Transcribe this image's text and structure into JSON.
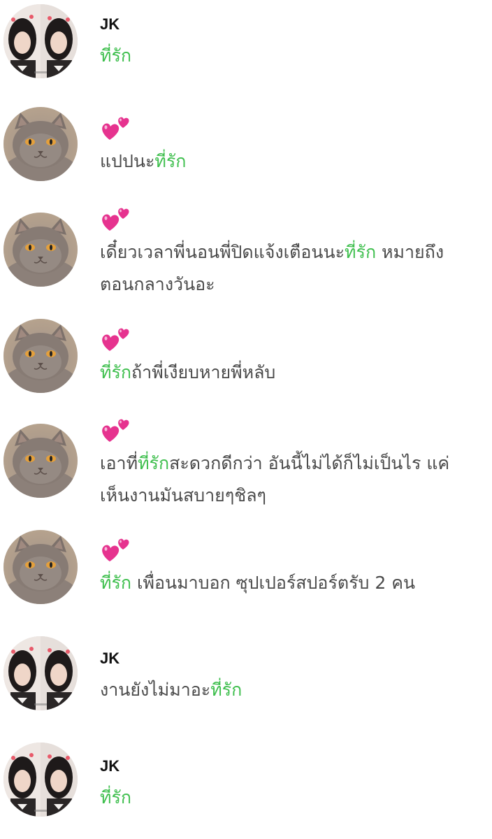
{
  "colors": {
    "highlight": "#3fbf4e",
    "body_text": "#4a4a4a",
    "sender": "#111111",
    "heart": "#e6338f"
  },
  "messages": [
    {
      "sender": "JK",
      "avatar": "jk-photo-avatar",
      "parts": [
        {
          "t": "ที่รัก",
          "hl": true
        }
      ]
    },
    {
      "avatar": "cat-avatar",
      "reaction": "two-hearts-icon",
      "parts": [
        {
          "t": "แปปนะ",
          "hl": false
        },
        {
          "t": "ที่รัก",
          "hl": true
        }
      ]
    },
    {
      "avatar": "cat-avatar",
      "reaction": "two-hearts-icon",
      "parts": [
        {
          "t": "เดี๋ยวเวลาพี่นอนพี่ปิดแจ้งเตือนนะ",
          "hl": false
        },
        {
          "t": "ที่รัก",
          "hl": true
        },
        {
          "t": " หมายถึง",
          "hl": false
        },
        {
          "br": true
        },
        {
          "t": "ตอนกลางวันอะ",
          "hl": false
        }
      ]
    },
    {
      "avatar": "cat-avatar",
      "reaction": "two-hearts-icon",
      "parts": [
        {
          "t": "ที่รัก",
          "hl": true
        },
        {
          "t": "ถ้าพี่เงียบหายพี่หลับ",
          "hl": false
        }
      ]
    },
    {
      "avatar": "cat-avatar",
      "reaction": "two-hearts-icon",
      "parts": [
        {
          "t": "เอาที่",
          "hl": false
        },
        {
          "t": "ที่รัก",
          "hl": true
        },
        {
          "t": "สะดวกดีกว่า อันนี้ไม่ได้ก็ไม่เป็นไร แค่",
          "hl": false
        },
        {
          "br": true
        },
        {
          "t": "เห็นงานมันสบายๆชิลๆ",
          "hl": false
        }
      ]
    },
    {
      "avatar": "cat-avatar",
      "reaction": "two-hearts-icon",
      "parts": [
        {
          "t": "ที่รัก",
          "hl": true
        },
        {
          "t": " เพื่อนมาบอก ซุปเปอร์สปอร์ตรับ 2 คน",
          "hl": false
        }
      ]
    },
    {
      "sender": "JK",
      "avatar": "jk-photo-avatar",
      "parts": [
        {
          "t": "งานยังไม่มาอะ",
          "hl": false
        },
        {
          "t": "ที่รัก",
          "hl": true
        }
      ]
    },
    {
      "sender": "JK",
      "avatar": "jk-photo-avatar",
      "parts": [
        {
          "t": "ที่รัก",
          "hl": true
        }
      ]
    }
  ]
}
